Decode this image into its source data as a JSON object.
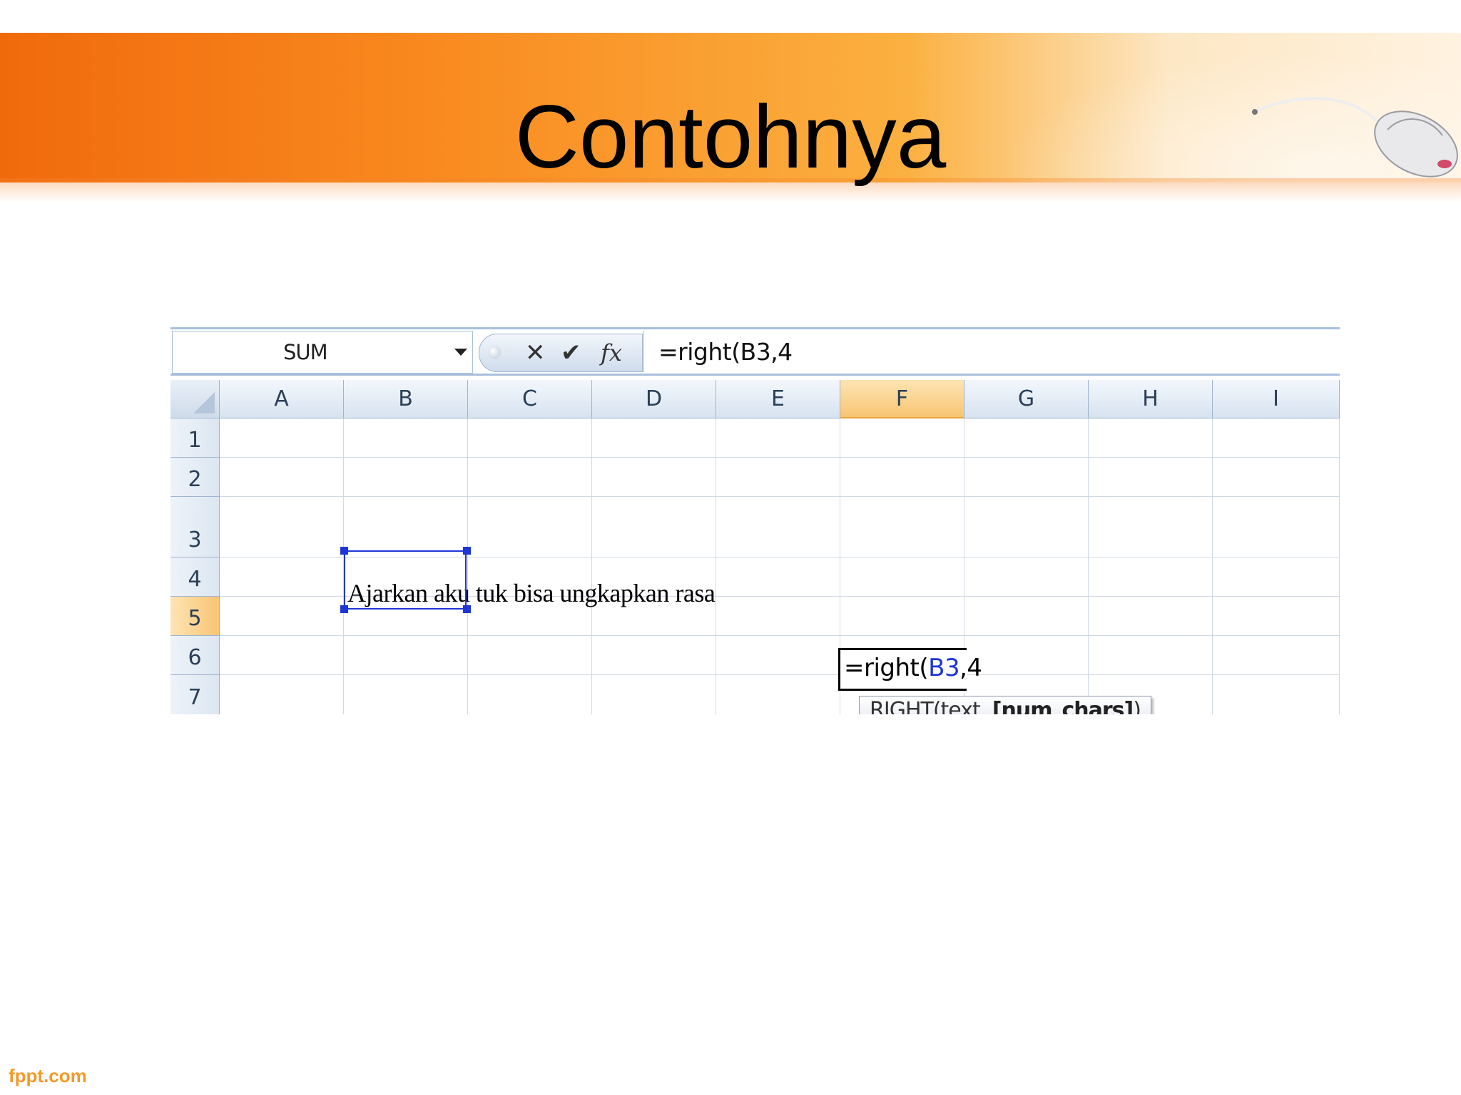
{
  "slide": {
    "title": "Contohnya",
    "footer": "fppt.com",
    "accent_color": "#f06a0c"
  },
  "formula_bar": {
    "name_box": "SUM",
    "cancel_icon": "✕",
    "enter_icon": "✔",
    "insert_function_label": "fx",
    "formula": "=right(B3,4"
  },
  "columns": [
    "A",
    "B",
    "C",
    "D",
    "E",
    "F",
    "G",
    "H",
    "I"
  ],
  "rows": [
    "1",
    "2",
    "3",
    "4",
    "5",
    "6",
    "7"
  ],
  "active_column": "F",
  "active_row": "5",
  "cells": {
    "B3": "Ajarkan aku tuk bisa ungkapkan rasa",
    "F5": {
      "prefix": "=right(",
      "ref": "B3",
      "suffix": ",4"
    }
  },
  "tooltip": {
    "function": "RIGHT(text, ",
    "optional_arg": "[num_chars]",
    "close": ")"
  },
  "colors": {
    "reference_blue": "#1f36d6",
    "header_active": "#f8c572",
    "grid_line": "#d0d9e6"
  }
}
